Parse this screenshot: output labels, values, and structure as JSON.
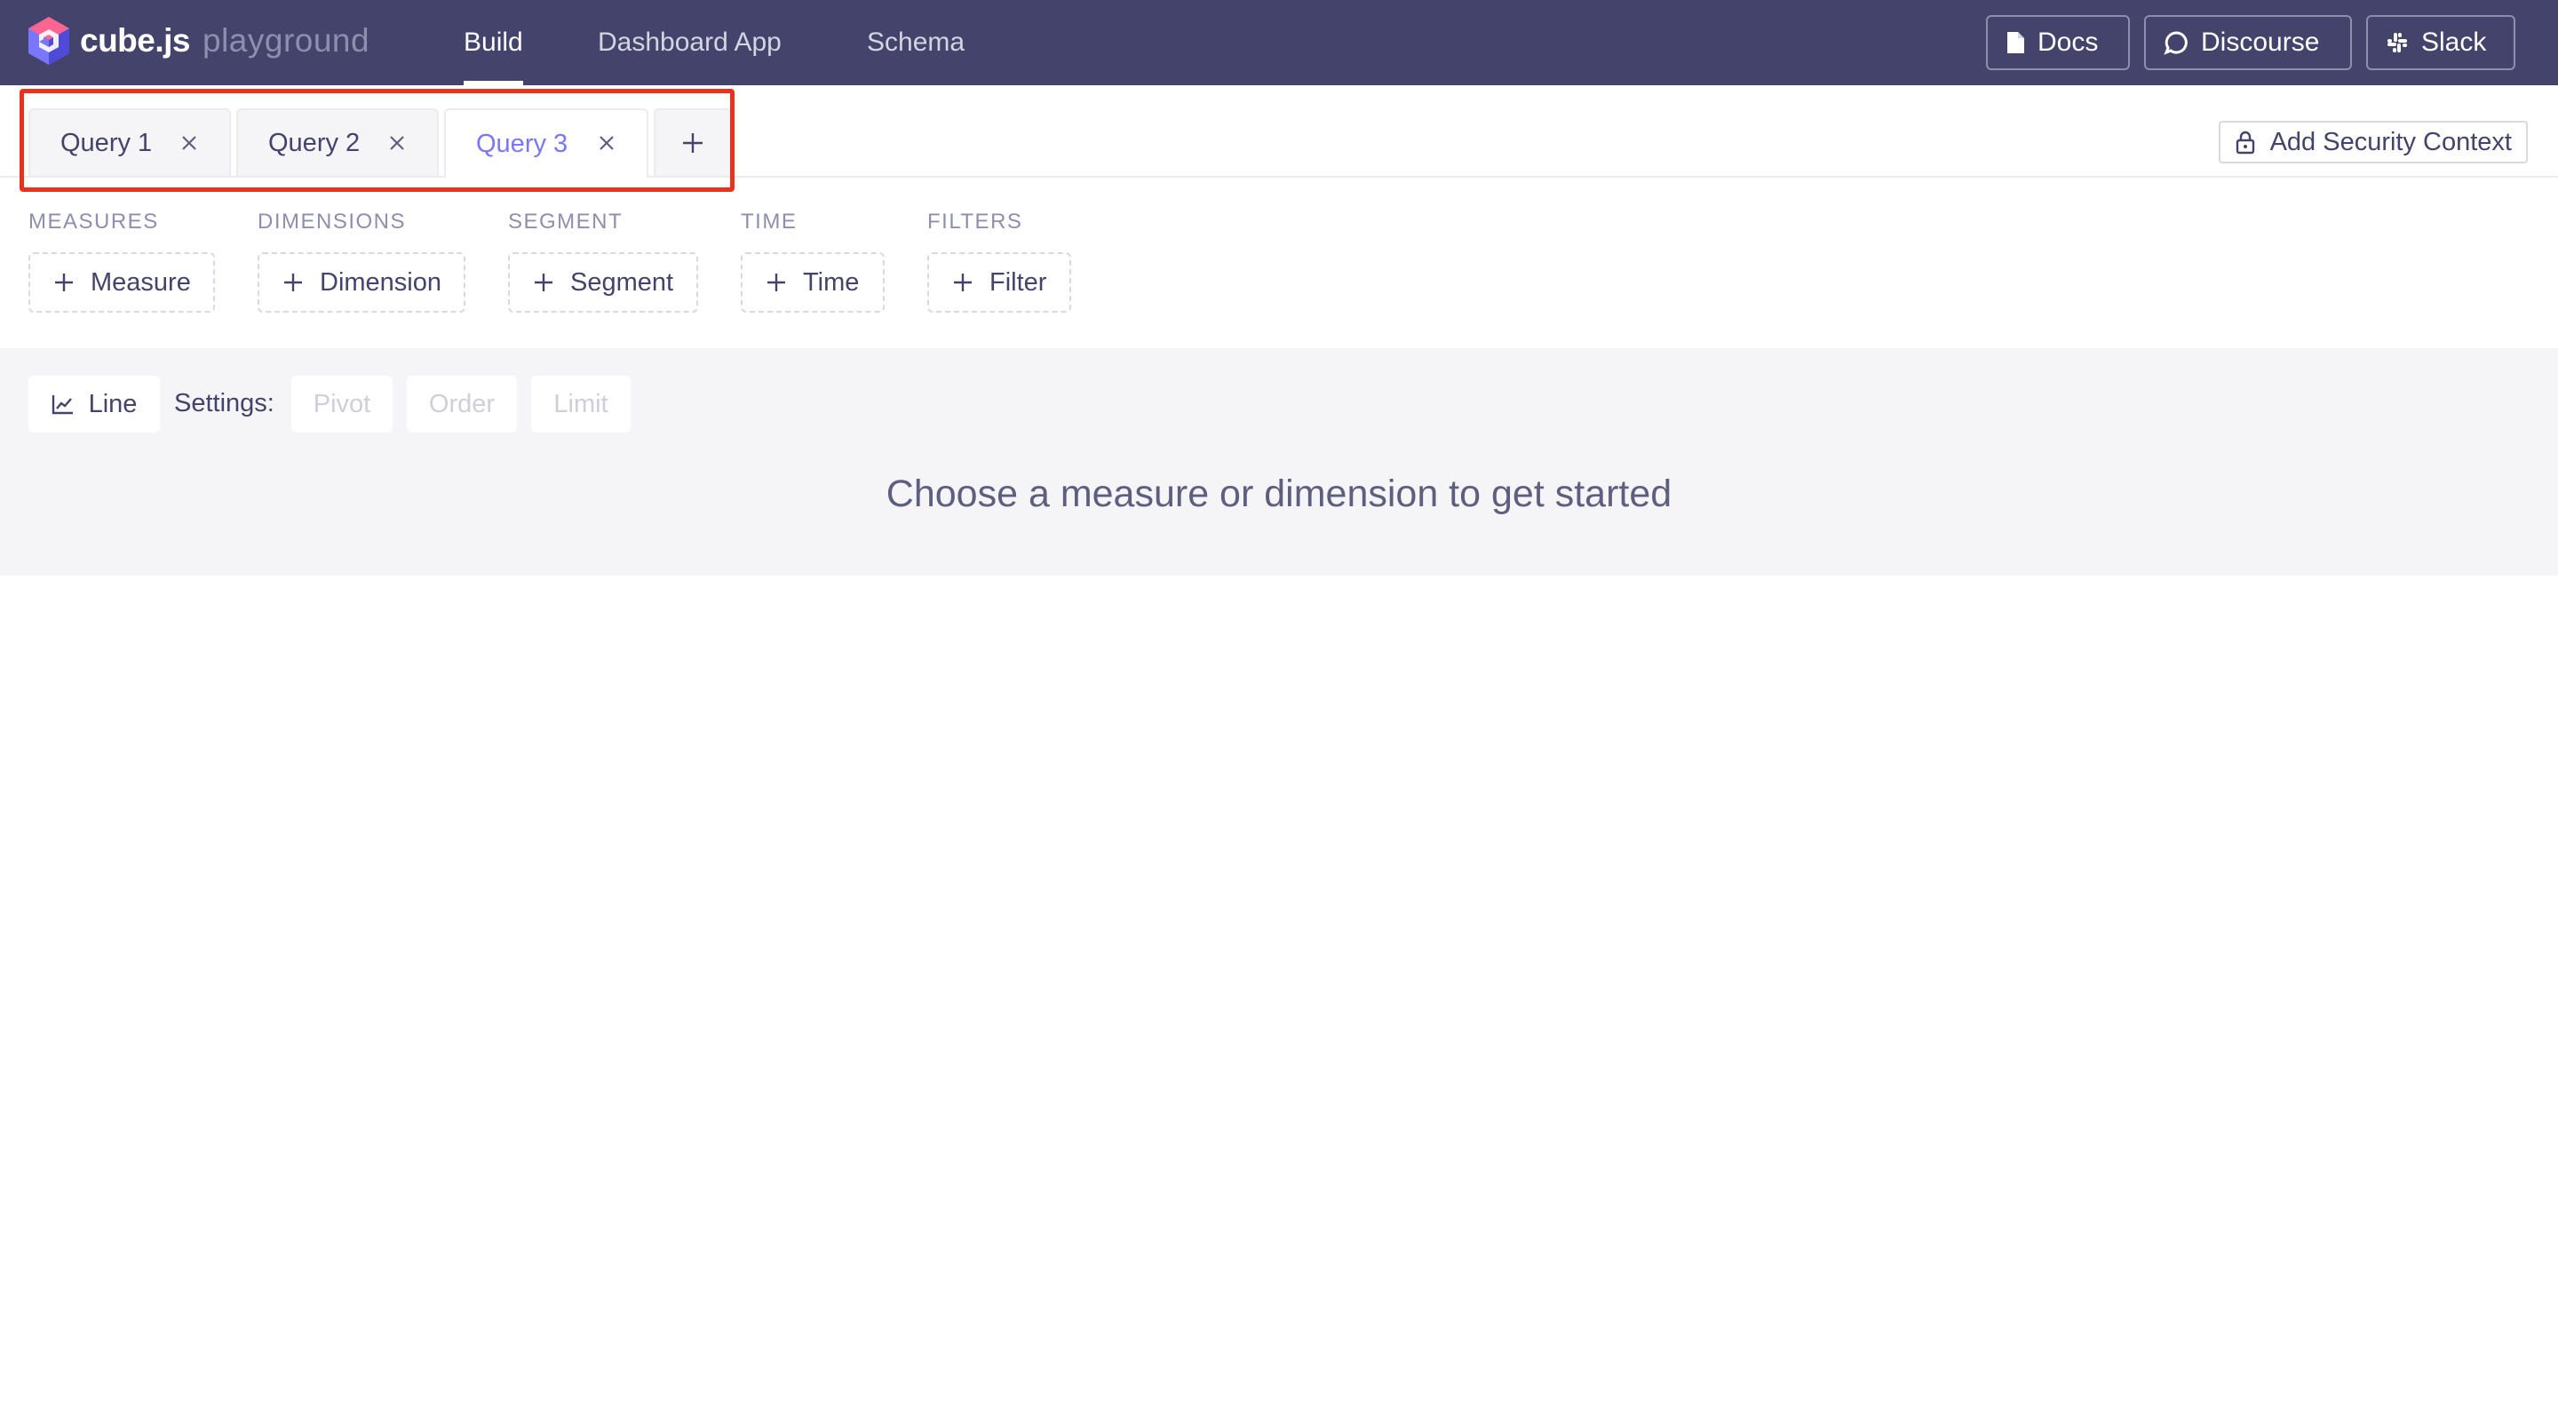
{
  "app": {
    "brand": "cube.js",
    "subtitle": "playground"
  },
  "nav": [
    {
      "label": "Build",
      "active": true
    },
    {
      "label": "Dashboard App",
      "active": false
    },
    {
      "label": "Schema",
      "active": false
    }
  ],
  "header_buttons": [
    {
      "label": "Docs",
      "icon": "document-icon"
    },
    {
      "label": "Discourse",
      "icon": "chat-bubble-icon"
    },
    {
      "label": "Slack",
      "icon": "slack-icon"
    }
  ],
  "tabs": [
    {
      "label": "Query 1",
      "active": false
    },
    {
      "label": "Query 2",
      "active": false
    },
    {
      "label": "Query 3",
      "active": true
    }
  ],
  "security_button": {
    "label": "Add Security Context",
    "icon": "lock-icon"
  },
  "query_builder": {
    "groups": [
      {
        "label": "MEASURES",
        "button": "Measure"
      },
      {
        "label": "DIMENSIONS",
        "button": "Dimension"
      },
      {
        "label": "SEGMENT",
        "button": "Segment"
      },
      {
        "label": "TIME",
        "button": "Time"
      },
      {
        "label": "FILTERS",
        "button": "Filter"
      }
    ]
  },
  "chart_controls": {
    "chart_type": "Line",
    "settings_label": "Settings:",
    "settings": [
      "Pivot",
      "Order",
      "Limit"
    ]
  },
  "empty_state": "Choose a measure or dimension to get started",
  "colors": {
    "header_bg": "#43436b",
    "accent": "#7a77ff",
    "highlight": "#e8321e",
    "panel_bg": "#f5f5f7"
  }
}
